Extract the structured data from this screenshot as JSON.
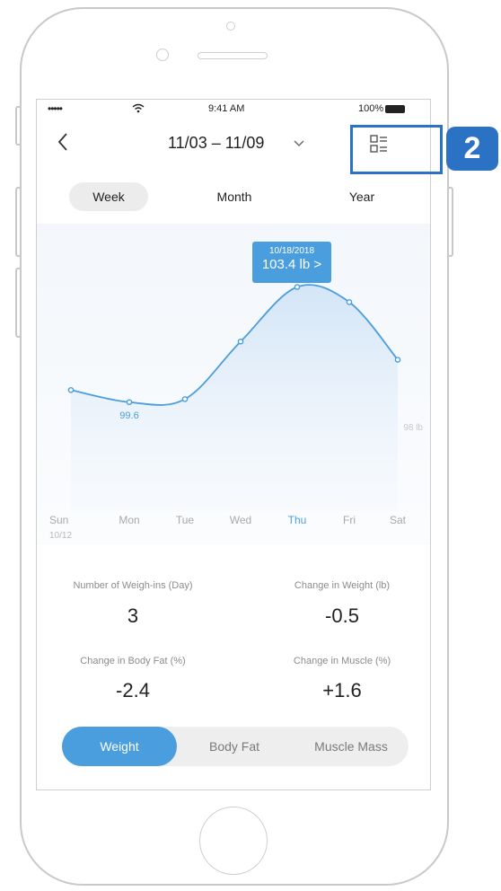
{
  "status_bar": {
    "signal": "•••••",
    "time": "9:41 AM",
    "battery": "100%"
  },
  "header": {
    "date_range": "11/03 – 11/09",
    "back_icon": "chevron-left-icon",
    "dropdown_icon": "chevron-down-icon",
    "view_icon": "list-view-icon"
  },
  "period_tabs": [
    {
      "label": "Week",
      "active": true
    },
    {
      "label": "Month",
      "active": false
    },
    {
      "label": "Year",
      "active": false
    }
  ],
  "tooltip": {
    "date": "10/18/2018",
    "value": "103.4 lb >"
  },
  "chart_data": {
    "type": "line",
    "categories": [
      "Sun",
      "Mon",
      "Tue",
      "Wed",
      "Thu",
      "Fri",
      "Sat"
    ],
    "series": [
      {
        "values": [
          100.0,
          99.6,
          99.7,
          101.6,
          103.4,
          102.9,
          101.0
        ]
      }
    ],
    "data_labels": {
      "max": "103.4",
      "min": "99.6"
    },
    "ref_label": "98 lb",
    "first_date": "10/12",
    "highlighted_category": "Thu",
    "ylim": [
      96.6,
      104.6
    ],
    "colors": {
      "line": "#4a9ede",
      "highlight": "#4a9ede"
    }
  },
  "stats": [
    {
      "label": "Number of Weigh-ins (Day)",
      "value": "3"
    },
    {
      "label": "Change in Weight (lb)",
      "value": "-0.5"
    },
    {
      "label": "Change in Body Fat (%)",
      "value": "-2.4"
    },
    {
      "label": "Change in Muscle (%)",
      "value": "+1.6"
    }
  ],
  "metric_tabs": [
    {
      "label": "Weight",
      "active": true
    },
    {
      "label": "Body Fat",
      "active": false
    },
    {
      "label": "Muscle Mass",
      "active": false
    }
  ],
  "annotation": {
    "number": "2"
  },
  "colors": {
    "accent": "#4a9ede",
    "annotation": "#2b72c4"
  }
}
